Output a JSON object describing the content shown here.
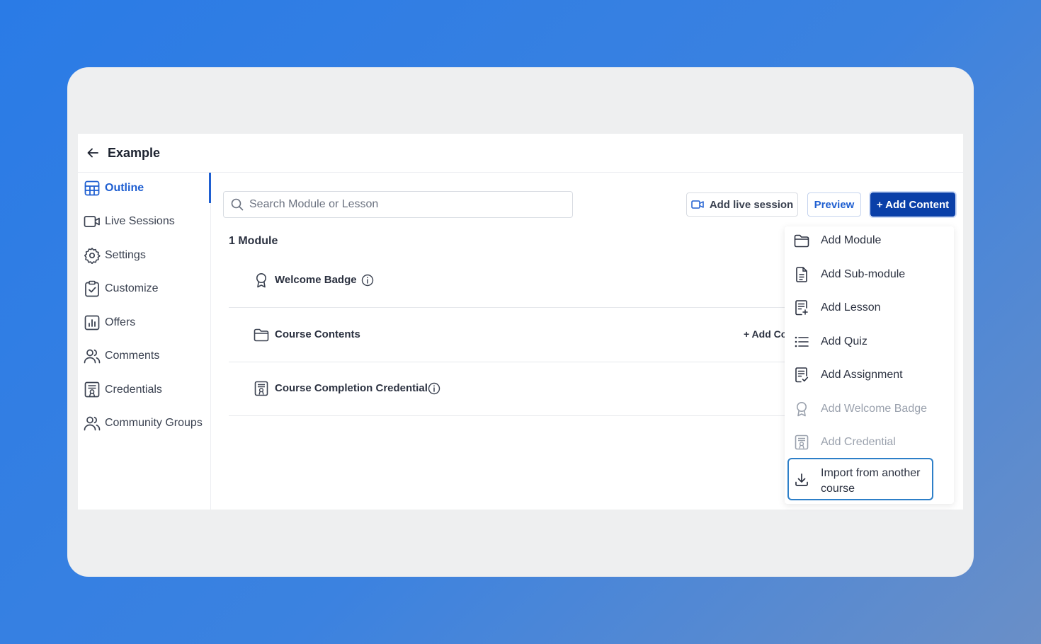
{
  "header": {
    "title": "Example"
  },
  "sidebar": {
    "items": [
      {
        "label": "Outline",
        "icon": "outline-grid-icon",
        "active": true
      },
      {
        "label": "Live Sessions",
        "icon": "video-camera-icon"
      },
      {
        "label": "Settings",
        "icon": "gear-icon"
      },
      {
        "label": "Customize",
        "icon": "clipboard-check-icon"
      },
      {
        "label": "Offers",
        "icon": "bar-chart-icon"
      },
      {
        "label": "Comments",
        "icon": "users-icon"
      },
      {
        "label": "Credentials",
        "icon": "certificate-icon"
      },
      {
        "label": "Community Groups",
        "icon": "users-icon"
      }
    ]
  },
  "toolbar": {
    "search_placeholder": "Search Module or Lesson",
    "live_label": "Add live session",
    "preview_label": "Preview",
    "add_content_label": "+ Add Content"
  },
  "content": {
    "module_count": "1 Module",
    "rows": [
      {
        "label": "Welcome Badge",
        "icon": "badge-icon",
        "info": true
      },
      {
        "label": "Course Contents",
        "icon": "folder-icon",
        "add_label": "+ Add Content"
      },
      {
        "label": "Course Completion Credential",
        "icon": "certificate-icon",
        "info": true
      }
    ]
  },
  "dropdown": {
    "items": [
      {
        "label": "Add Module",
        "icon": "folder-icon"
      },
      {
        "label": "Add Sub-module",
        "icon": "document-icon"
      },
      {
        "label": "Add Lesson",
        "icon": "lesson-icon"
      },
      {
        "label": "Add Quiz",
        "icon": "list-icon"
      },
      {
        "label": "Add Assignment",
        "icon": "assignment-icon"
      },
      {
        "label": "Add Welcome Badge",
        "icon": "badge-icon",
        "disabled": true
      },
      {
        "label": "Add Credential",
        "icon": "certificate-icon",
        "disabled": true
      }
    ],
    "import_label": "Import from another course"
  },
  "colors": {
    "accent": "#1f5fd1",
    "primary_button": "#0a3fa8",
    "focus_ring": "#2d7fc8"
  }
}
